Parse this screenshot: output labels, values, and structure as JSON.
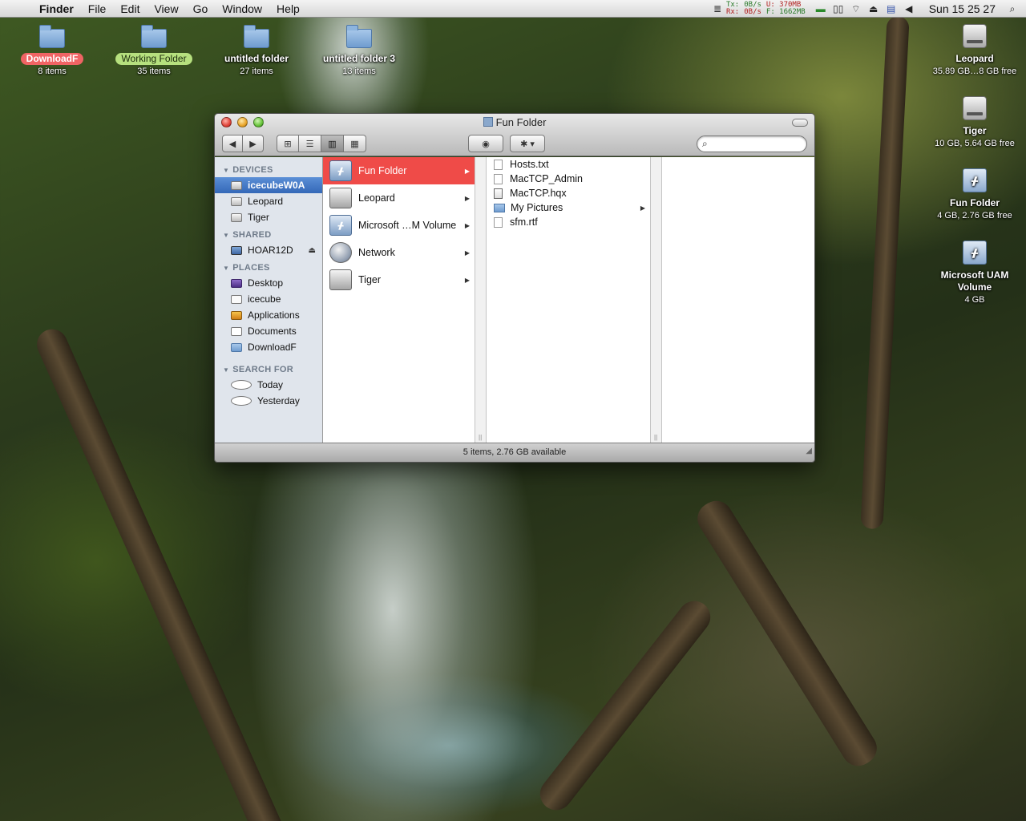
{
  "menubar": {
    "app_name": "Finder",
    "items": [
      "File",
      "Edit",
      "View",
      "Go",
      "Window",
      "Help"
    ],
    "net": {
      "tx_label": "Tx:",
      "rx_label": "Rx:",
      "tx_rate": "0B/s",
      "rx_rate": "0B/s",
      "mem_used": "U: 370MB",
      "mem_free": "F: 1662MB"
    },
    "clock": "Sun 15 25 27"
  },
  "desktop": {
    "top_icons": [
      {
        "name": "DownloadF",
        "sub": "8 items"
      },
      {
        "name": "Working Folder",
        "sub": "35 items"
      },
      {
        "name": "untitled folder",
        "sub": "27 items"
      },
      {
        "name": "untitled folder 3",
        "sub": "13 items"
      }
    ],
    "right_icons": [
      {
        "name": "Leopard",
        "sub": "35.89 GB…8 GB free"
      },
      {
        "name": "Tiger",
        "sub": "10 GB, 5.64 GB free"
      },
      {
        "name": "Fun Folder",
        "sub": "4 GB, 2.76 GB free"
      },
      {
        "name": "Microsoft UAM Volume",
        "sub": "4 GB"
      }
    ]
  },
  "window": {
    "title": "Fun Folder",
    "search_placeholder": "",
    "sidebar": {
      "devices_label": "DEVICES",
      "devices": [
        "icecubeW0A",
        "Leopard",
        "Tiger"
      ],
      "shared_label": "SHARED",
      "shared": [
        "HOAR12D"
      ],
      "places_label": "PLACES",
      "places": [
        "Desktop",
        "icecube",
        "Applications",
        "Documents",
        "DownloadF"
      ],
      "search_label": "SEARCH FOR",
      "search": [
        "Today",
        "Yesterday"
      ]
    },
    "column1": [
      "Fun Folder",
      "Leopard",
      "Microsoft …M Volume",
      "Network",
      "Tiger"
    ],
    "column2": [
      "Hosts.txt",
      "MacTCP_Admin",
      "MacTCP.hqx",
      "My Pictures",
      "sfm.rtf"
    ],
    "status": "5 items, 2.76 GB available"
  },
  "colors": {
    "selection_red": "#ef4b48",
    "sidebar_selection": "#3468b8",
    "label_red": "#f06464",
    "label_green": "#b6e07e"
  }
}
